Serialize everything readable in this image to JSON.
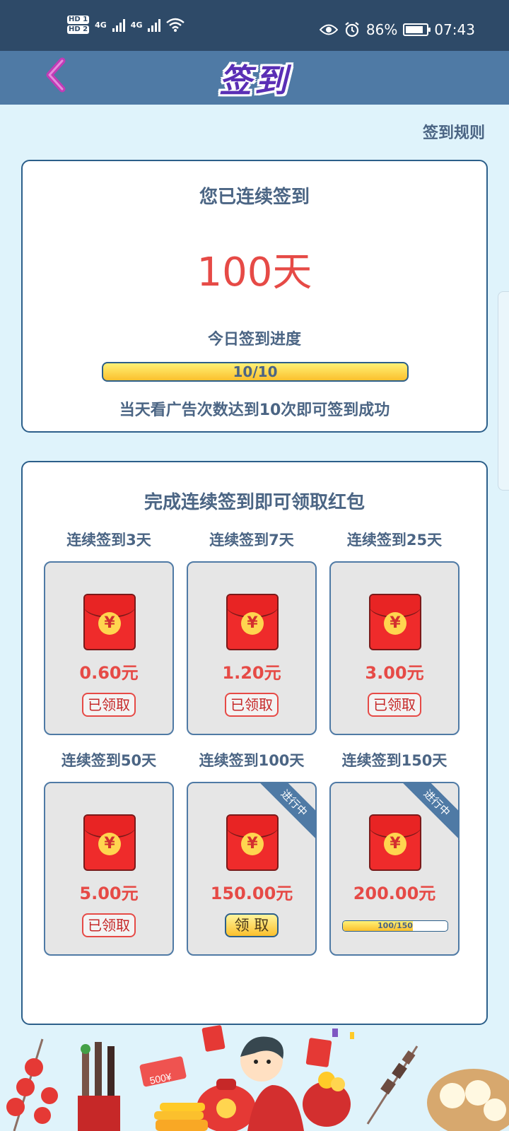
{
  "status_bar": {
    "hd1": "HD 1",
    "hd2": "HD 2",
    "net1": "4G",
    "net2": "4G",
    "battery": "86%",
    "time": "07:43",
    "icons": [
      "eye-icon",
      "alarm-icon",
      "battery-icon",
      "wifi-icon",
      "signal-icon"
    ]
  },
  "header": {
    "title": "签到",
    "back_icon": "chevron-left-icon"
  },
  "rules_link": "签到规则",
  "checkin": {
    "title": "您已连续签到",
    "days": "100天",
    "progress_label": "今日签到进度",
    "progress_text": "10/10",
    "progress_fraction": 1.0,
    "note": "当天看广告次数达到10次即可签到成功"
  },
  "rewards": {
    "title": "完成连续签到即可领取红包",
    "items": [
      {
        "label": "连续签到3天",
        "amount": "0.60元",
        "status": "已领取"
      },
      {
        "label": "连续签到7天",
        "amount": "1.20元",
        "status": "已领取"
      },
      {
        "label": "连续签到25天",
        "amount": "3.00元",
        "status": "已领取"
      },
      {
        "label": "连续签到50天",
        "amount": "5.00元",
        "status": "已领取"
      },
      {
        "label": "连续签到100天",
        "amount": "150.00元",
        "status": "领 取",
        "ribbon": "进行中"
      },
      {
        "label": "连续签到150天",
        "amount": "200.00元",
        "progress": "100/150",
        "ribbon": "进行中",
        "progress_fraction": 0.667
      }
    ]
  },
  "decor": {
    "tag_text": "500¥"
  },
  "colors": {
    "accent_red": "#e64a46",
    "header_blue": "#4f7aa5",
    "title_purple": "#5a2fb5",
    "bg": "#dff3fb"
  }
}
